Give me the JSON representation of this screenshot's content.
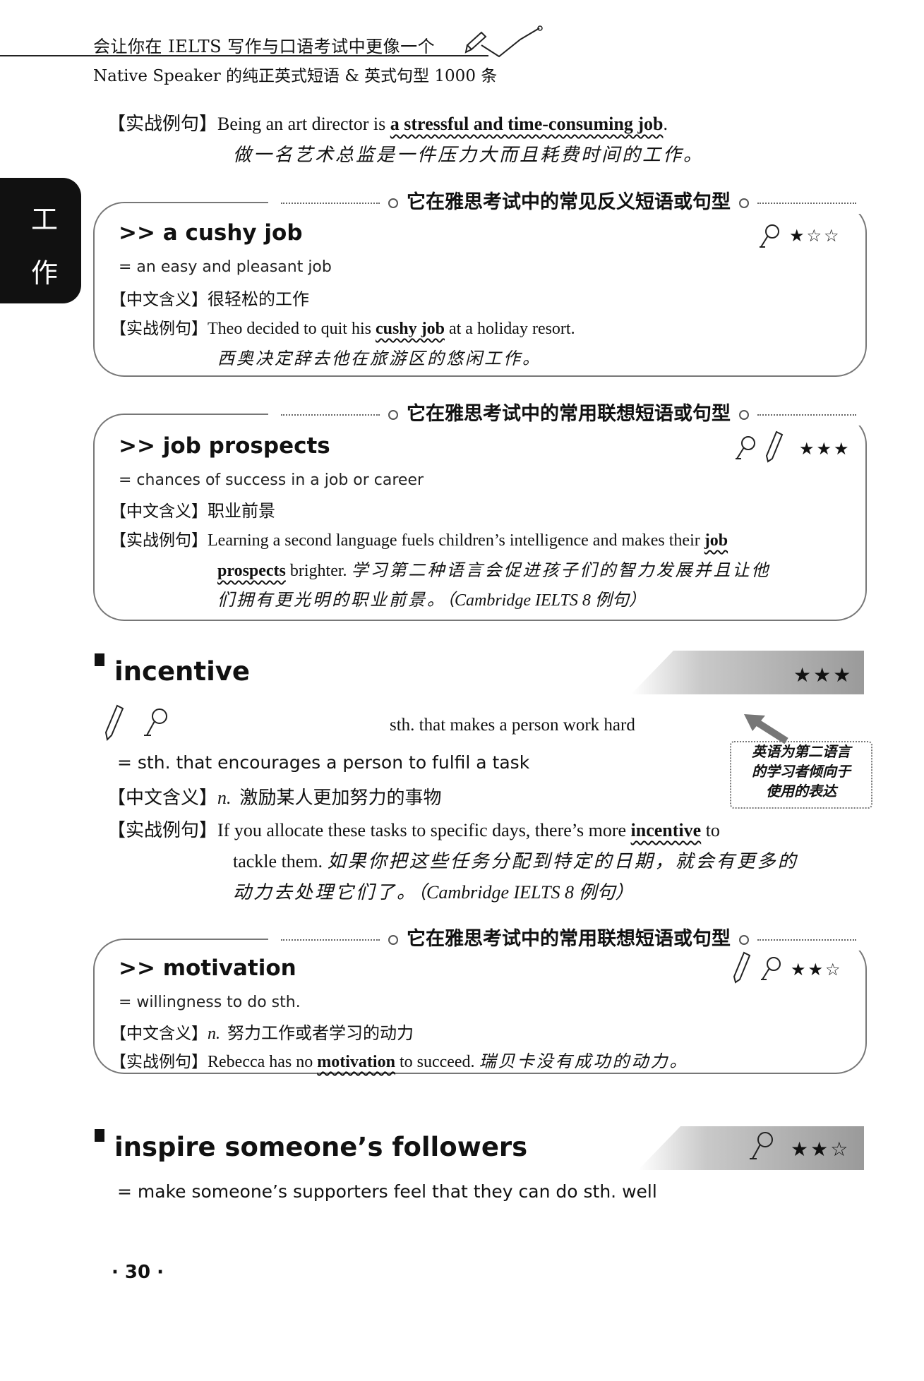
{
  "header": {
    "line1": "会让你在 IELTS 写作与口语考试中更像一个",
    "line2": "Native Speaker 的纯正英式短语 & 英式句型 1000 条"
  },
  "side_tab": {
    "char1": "工",
    "char2": "作"
  },
  "labels": {
    "example": "【实战例句】",
    "meaning": "【中文含义】"
  },
  "top_example": {
    "pre": "Being an art director is ",
    "highlight": "a stressful and time-consuming job",
    "post": ".",
    "translation": "做一名艺术总监是一件压力大而且耗费时间的工作。"
  },
  "box1": {
    "title": "它在雅思考试中的常见反义短语或句型",
    "phrase": ">> a cushy job",
    "stars": "★☆☆",
    "definition": "= an easy and pleasant job",
    "meaning": "很轻松的工作",
    "example_pre": "Theo decided to quit his ",
    "example_highlight": "cushy job",
    "example_post": " at a holiday resort.",
    "translation": "西奥决定辞去他在旅游区的悠闲工作。"
  },
  "box2": {
    "title": "它在雅思考试中的常用联想短语或句型",
    "phrase": ">> job prospects",
    "stars": "★★★",
    "definition": "= chances of success in a job or career",
    "meaning": "职业前景",
    "example_line1_pre": "Learning a second language fuels children’s intelligence and makes their ",
    "example_line1_hl": "job",
    "example_line2_hl": "prospects",
    "example_line2_post": " brighter. ",
    "translation_part1": "学习第二种语言会促进孩子们的智力发展并且让他",
    "translation_part2": "们拥有更光明的职业前景。",
    "source": "（Cambridge IELTS 8 例句）"
  },
  "entry1": {
    "headword": "incentive",
    "stars": "★★★",
    "native_def": "sth. that makes a person work hard",
    "learner_def": "= sth. that encourages a person to fulfil a task",
    "note": "英语为第二语言的学习者倾向于使用的表达",
    "note_l1": "英语为第二语言",
    "note_l2": "的学习者倾向于",
    "note_l3": "使用的表达",
    "pos": "n.",
    "meaning": "激励某人更加努力的事物",
    "example_pre": "If you allocate these tasks to specific days, there’s more ",
    "example_hl": "incentive",
    "example_post": " to",
    "example_line2": "tackle them. ",
    "translation_part1": "如果你把这些任务分配到特定的日期，就会有更多的",
    "translation_part2": "动力去处理它们了。",
    "source": "（Cambridge IELTS 8 例句）"
  },
  "box3": {
    "title": "它在雅思考试中的常用联想短语或句型",
    "phrase": ">> motivation",
    "stars": "★★☆",
    "definition": "= willingness to do sth.",
    "pos": "n.",
    "meaning": "努力工作或者学习的动力",
    "example_pre": "Rebecca has no ",
    "example_hl": "motivation",
    "example_post": " to succeed. ",
    "translation": "瑞贝卡没有成功的动力。"
  },
  "entry2": {
    "headword": "inspire someone’s followers",
    "stars": "★★☆",
    "definition": "= make someone’s supporters feel that they can do sth. well"
  },
  "page_number": "· 30 ·"
}
